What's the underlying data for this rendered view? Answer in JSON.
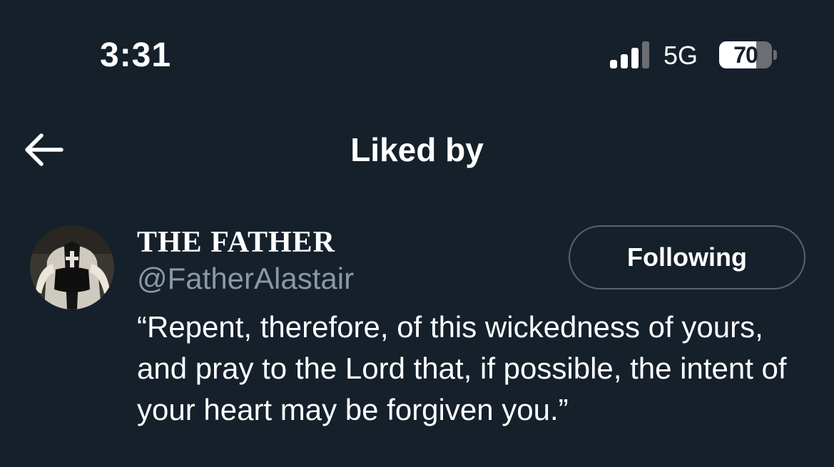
{
  "status_bar": {
    "time": "3:31",
    "network": "5G",
    "battery_level": "70",
    "battery_fraction": 0.7,
    "signal_bars_active": 3,
    "signal_bars_total": 4
  },
  "header": {
    "back_icon": "arrow-left-icon",
    "title": "Liked by"
  },
  "users": [
    {
      "display_name": "THE FATHER",
      "handle": "@FatherAlastair",
      "follow_label": "Following",
      "bio": "“Repent, therefore, of this wickedness of yours, and pray to the Lord that, if possible, the intent of your heart may be forgiven you.”"
    }
  ],
  "colors": {
    "background": "#15202b",
    "text_primary": "#ffffff",
    "text_secondary": "#8b98a5",
    "button_border": "#536471"
  }
}
